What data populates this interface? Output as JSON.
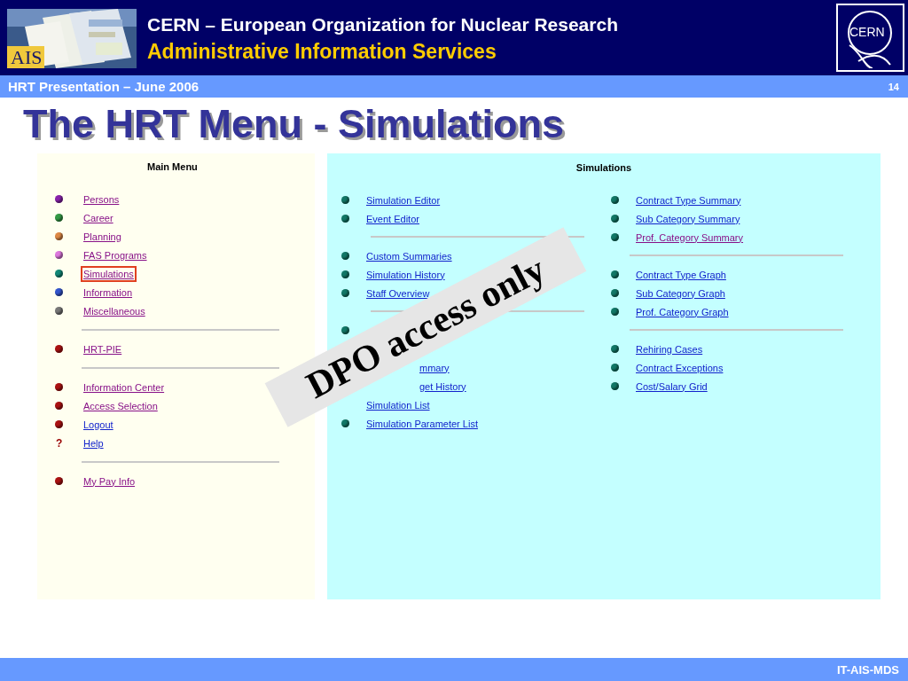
{
  "header": {
    "logo": {
      "kind": "picture",
      "text": "AIS"
    },
    "title": "CERN – European Organization for Nuclear Research",
    "subtitle": "Administrative Information Services",
    "emblem_text": "CERN"
  },
  "info_bar": {
    "title": "HRT Presentation – June 2006",
    "page": "14"
  },
  "slide_title": "The HRT Menu - Simulations",
  "main_menu": {
    "title": "Main Menu",
    "groups": [
      [
        {
          "kind": "link",
          "label": "Persons",
          "color": "#8822aa",
          "visited": true,
          "selected": false
        },
        {
          "kind": "link",
          "label": "Career",
          "color": "#339944",
          "visited": true,
          "selected": false
        },
        {
          "kind": "link",
          "label": "Planning",
          "color": "#dd8844",
          "visited": true,
          "selected": false
        },
        {
          "kind": "link",
          "label": "FAS Programs",
          "color": "#dd77dd",
          "visited": true,
          "selected": false
        },
        {
          "kind": "link",
          "label": "Simulations",
          "color": "#118877",
          "visited": true,
          "selected": true
        },
        {
          "kind": "link",
          "label": "Information",
          "color": "#3355cc",
          "visited": true,
          "selected": false
        },
        {
          "kind": "link",
          "label": "Miscellaneous",
          "color": "#777777",
          "visited": true,
          "selected": false
        }
      ],
      [
        {
          "kind": "link",
          "label": "HRT-PIE",
          "color": "#aa1111",
          "visited": true,
          "selected": false
        }
      ],
      [
        {
          "kind": "link",
          "label": "Information Center",
          "color": "#aa1111",
          "visited": true,
          "selected": false
        },
        {
          "kind": "link",
          "label": "Access Selection",
          "color": "#aa1111",
          "visited": true,
          "selected": false
        },
        {
          "kind": "link",
          "label": "Logout",
          "color": "#aa1111",
          "visited": false,
          "selected": false
        },
        {
          "kind": "help",
          "marker": "?",
          "label": "Help",
          "visited": false,
          "selected": false
        }
      ],
      [
        {
          "kind": "link",
          "label": "My Pay Info",
          "color": "#aa1111",
          "visited": true,
          "selected": false
        }
      ]
    ]
  },
  "simulations": {
    "title": "Simulations",
    "columns": [
      [
        [
          {
            "kind": "link",
            "label": "Simulation Editor",
            "visited": false
          },
          {
            "kind": "link",
            "label": "Event Editor",
            "visited": false
          }
        ],
        [
          {
            "kind": "link",
            "label": "Custom Summaries",
            "visited": false
          },
          {
            "kind": "link",
            "label": "Simulation History",
            "visited": false
          },
          {
            "kind": "link",
            "label": "Staff Overview",
            "visited": false
          }
        ],
        [
          {
            "kind": "dot_only"
          },
          {
            "kind": "covered"
          },
          {
            "kind": "fragment",
            "label": "mmary",
            "visited": false
          },
          {
            "kind": "fragment",
            "label": "get History",
            "visited": false
          },
          {
            "kind": "no_dot",
            "label": "Simulation List",
            "visited": false
          },
          {
            "kind": "link",
            "label": "Simulation Parameter List",
            "visited": false
          }
        ]
      ],
      [
        [
          {
            "kind": "link",
            "label": "Contract Type Summary",
            "visited": false
          },
          {
            "kind": "link",
            "label": "Sub Category Summary",
            "visited": false
          },
          {
            "kind": "link",
            "label": "Prof. Category Summary",
            "visited": true
          }
        ],
        [
          {
            "kind": "link",
            "label": "Contract Type Graph",
            "visited": false
          },
          {
            "kind": "link",
            "label": "Sub Category Graph",
            "visited": false
          },
          {
            "kind": "link",
            "label": "Prof. Category Graph",
            "visited": false
          }
        ],
        [
          {
            "kind": "link",
            "label": "Rehiring Cases",
            "visited": false
          },
          {
            "kind": "link",
            "label": "Contract Exceptions",
            "visited": false
          },
          {
            "kind": "link",
            "label": "Cost/Salary Grid",
            "visited": false
          }
        ]
      ]
    ]
  },
  "stamp": "DPO access only",
  "footer": "IT-AIS-MDS"
}
